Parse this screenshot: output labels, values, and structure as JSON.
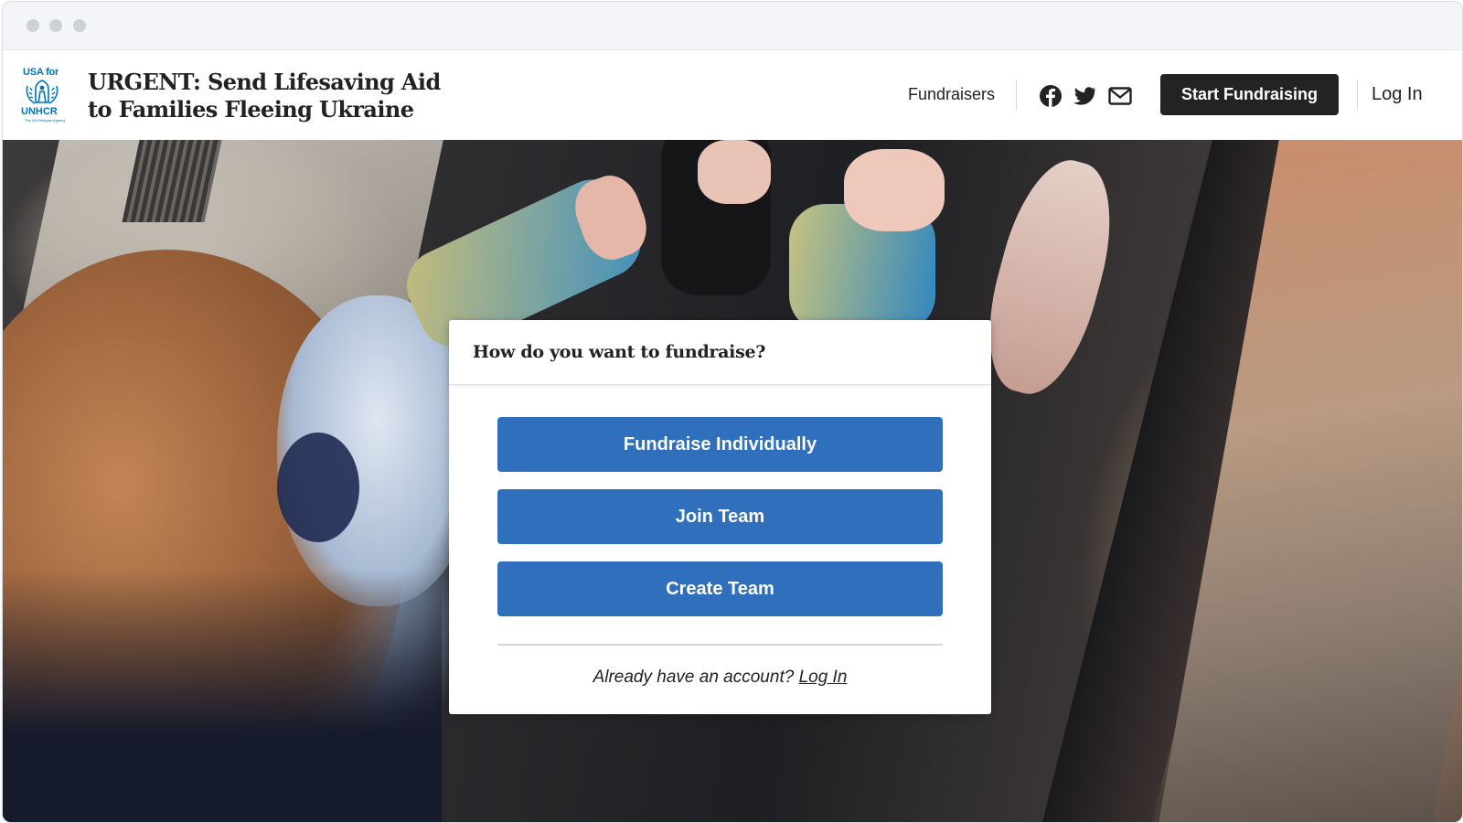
{
  "site": {
    "logo_top": "USA for",
    "logo_bottom": "UNHCR",
    "logo_tagline": "The UN Refugee Agency",
    "title": "URGENT: Send Lifesaving Aid\nto Families Fleeing Ukraine"
  },
  "nav": {
    "fundraisers": "Fundraisers",
    "social_icons": [
      "facebook-icon",
      "twitter-icon",
      "mail-icon"
    ],
    "start_fundraising": "Start Fundraising",
    "log_in": "Log In"
  },
  "modal": {
    "title": "How do you want to fundraise?",
    "options": [
      "Fundraise Individually",
      "Join Team",
      "Create Team"
    ],
    "account_prompt": "Already have an account?",
    "account_link": "Log In"
  },
  "colors": {
    "primary_button": "#2f6fbb",
    "dark_button": "#232323",
    "logo_blue": "#0072bc"
  }
}
